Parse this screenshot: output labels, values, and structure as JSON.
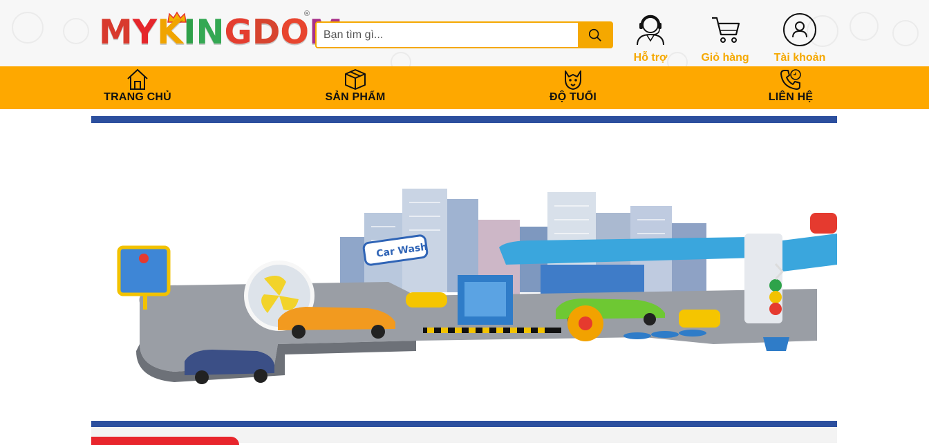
{
  "header": {
    "logo_text": "MYKINGDOM",
    "logo_mark": "®",
    "search": {
      "placeholder": "Bạn tìm gì..."
    },
    "actions": [
      {
        "label": "Hỗ trợ",
        "icon": "support-agent-icon"
      },
      {
        "label": "Giỏ hàng",
        "icon": "cart-icon"
      },
      {
        "label": "Tài khoản",
        "icon": "account-icon"
      }
    ]
  },
  "nav": {
    "items": [
      {
        "label": "TRANG CHỦ",
        "icon": "home-icon"
      },
      {
        "label": "SẢN PHẨM",
        "icon": "box-icon"
      },
      {
        "label": "ĐỘ TUỔI",
        "icon": "dog-face-icon"
      },
      {
        "label": "LIÊN HỆ",
        "icon": "phone-icon"
      }
    ]
  },
  "banner": {
    "product_image": "toy-car-wash-city-playset",
    "next_icon": "chevron-right-icon"
  },
  "colors": {
    "accent": "#fea800",
    "banner_bar": "#2c4f9e",
    "tab_red": "#e8252c"
  }
}
